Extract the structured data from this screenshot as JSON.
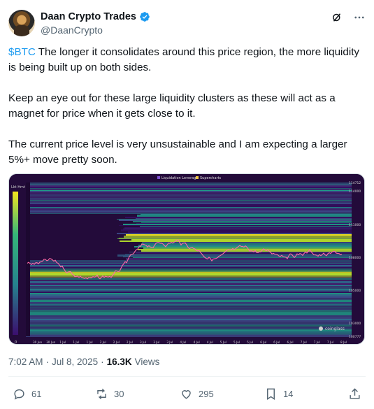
{
  "author": {
    "name": "Daan Crypto Trades",
    "handle": "@DaanCrypto",
    "verified": true
  },
  "header_icons": [
    "grok-icon",
    "more-icon"
  ],
  "tweet": {
    "cashtag": "$BTC",
    "para1_rest": " The longer it consolidates around this price region, the more liquidity is being built up on both sides.",
    "para2": "Keep an eye out for these large liquidity clusters as these will act as a magnet for price when it gets close to it.",
    "para3": "The current price level is very unsustainable and I am expecting a larger 5%+ move pretty soon."
  },
  "chart": {
    "legend": [
      "Liquidation Leverage",
      "Supercharts"
    ],
    "left_label": "Lkt Hmt",
    "watermark": "coinglass",
    "y_ticks": [
      "114712",
      "114000",
      "111000",
      "108000",
      "105000",
      "103000",
      "100777"
    ],
    "x_ticks": [
      "30 Jun",
      "30 Jun",
      "1 Jul",
      "1 Jul",
      "1 Jul",
      "2 Jul",
      "2 Jul",
      "2 Jul",
      "3 Jul",
      "3 Jul",
      "3 Jul",
      "4 Jul",
      "4 Jul",
      "4 Jul",
      "5 Jul",
      "5 Jul",
      "5 Jul",
      "6 Jul",
      "6 Jul",
      "6 Jul",
      "7 Jul",
      "7 Jul",
      "7 Jul",
      "8 Jul"
    ],
    "colorbar_bottom": "0"
  },
  "meta": {
    "time": "7:02 AM",
    "sep": "·",
    "date": "Jul 8, 2025",
    "sep2": "·",
    "views_count": "16.3K",
    "views_label": "Views"
  },
  "actions": {
    "replies": "61",
    "reposts": "30",
    "likes": "295",
    "bookmarks": "14"
  },
  "colors": {
    "accent": "#1d9bf0",
    "muted": "#536471",
    "heatmap_bg": "#2a0d45"
  }
}
